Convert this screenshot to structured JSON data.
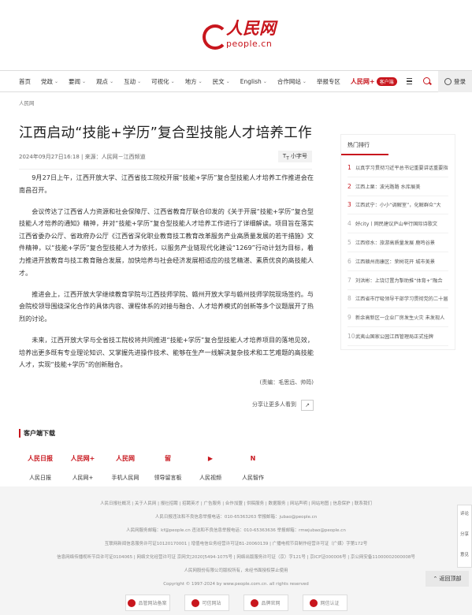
{
  "header": {
    "logo_cn": "人民网",
    "logo_en": "people.cn"
  },
  "nav": {
    "items": [
      "首页",
      "党政",
      "要闻",
      "观点",
      "互动",
      "可视化",
      "地方",
      "民文",
      "English",
      "合作网站",
      "举报专区"
    ],
    "app_brand": "人民网+",
    "app_tag": "客户端",
    "login": "登录"
  },
  "breadcrumb": "人民网",
  "article": {
    "title": "江西启动“技能+学历”复合型技能人才培养工作",
    "meta": "2024年09月27日16:18 | 来源：人民网－江西频道",
    "font_button": "小字号",
    "paragraphs": [
      "9月27日上午，江西开放大学、江西省技工院校开展“技能+学历”复合型技能人才培养工作推进会在南昌召开。",
      "会议传达了江西省人力资源和社会保障厅、江西省教育厅联合印发的《关于开展“技能+学历”复合型技能人才培养的通知》精神，并对“技能+学历”复合型技能人才培养工作进行了详细解读。项目旨在落实江西省委办公厅、省政府办公厅《江西省深化职业教育技工教育改革服务产业高质量发展的若干措施》文件精神，以“技能+学历”复合型技能人才为依托，以服务产业链现代化建设“1269”行动计划为目标，着力推进开放教育与技工教育融合发展，加快培养与社会经济发展相适应的技艺精湛、素质优良的高技能人才。",
      "推进会上，江西开放大学继续教育学院与江西技师学院、赣州开放大学与赣州技师学院现场签约。与会院校领导围绕深化合作的具体内容、课程体系的对接与融合、人才培养模式的创新等多个议题展开了热烈的讨论。",
      "未来，江西开放大学与全省技工院校将共同推进“技能+学历”复合型技能人才培养项目的落地见效，培养出更多既有专业理论知识、又掌握先进操作技术、能够在生产一线解决复杂技术和工艺难题的高技能人才，实现“技能+学历”的创新融合。"
    ],
    "editor": "(责编：毛思远、帅筠)",
    "share": "分享让更多人看到"
  },
  "sidebar": {
    "title": "热门排行",
    "items": [
      {
        "n": "1",
        "t": "以真学习贯彻习近平总书记重要讲话重要指"
      },
      {
        "n": "2",
        "t": "江西上栗：波光路路 水库展美"
      },
      {
        "n": "3",
        "t": "江西武宁：小小“调解室”，化解群众“大"
      },
      {
        "n": "4",
        "t": "好city丨网民建议庐山举行国际诗歌文"
      },
      {
        "n": "5",
        "t": "江西修水：旅游高质量发展 鹿鸣谷景"
      },
      {
        "n": "6",
        "t": "江西赣州南康区：荣树花开 城市美景"
      },
      {
        "n": "7",
        "t": "刘洪彬：上饶订置为掣助推“体育+”融合"
      },
      {
        "n": "8",
        "t": "江西省市厅吸领导干部学习贯彻党的二十届"
      },
      {
        "n": "9",
        "t": "新余高新区一企业厂房发生火灾 未发现人"
      },
      {
        "n": "10",
        "t": "武夷山国家公园江西管理局正式挂牌"
      }
    ]
  },
  "client": {
    "title": "客户端下载",
    "apps": [
      {
        "name": "人民日报",
        "icon": "人民日报"
      },
      {
        "name": "人民网+",
        "icon": "人民网+"
      },
      {
        "name": "手机人民网",
        "icon": "人民网"
      },
      {
        "name": "领导留言板",
        "icon": "留"
      },
      {
        "name": "人民视频",
        "icon": "▶"
      },
      {
        "name": "人民智作",
        "icon": "N"
      }
    ]
  },
  "footer": {
    "rows": [
      "人民日报社概况 | 关于人民网 | 报社招聘 | 招聘英才 | 广告服务 | 合作加盟 | 供稿服务 | 数据服务 | 网站声明 | 网站地图 | 信息保护 | 联系我们",
      "人民日报违法和不良信息举报电话：010-65363263    举报邮箱：jubao@people.cn",
      "人民网服务邮箱：kf@people.cn    违法和不良信息举报电话：010-65363636    举报邮箱：rmwjubao@people.cn",
      "互联网新闻信息服务许可证10120170001 | 增值电信业务经营许可证B1-20060139 | 广播电视节目制作经营许可证（广媒）字第172号",
      "信息网络传播视听节目许可证0104065 | 网络文化经营许可证 京网文[2020]5494-1075号 | 网络出版服务许可证（京）字121号 | 京ICP证000006号 | 京公网安备11000002000008号",
      "人民网股份有限公司版权所有，未经书面授权禁止使用",
      "Copyright © 1997-2024 by www.people.com.cn. all rights reserved"
    ],
    "badges": [
      "品管网站备案",
      "可信网站",
      "品牌官网",
      "网信认证"
    ]
  },
  "floatbar": [
    "评论",
    "分享",
    "意见"
  ],
  "backtop": "返回顶部"
}
